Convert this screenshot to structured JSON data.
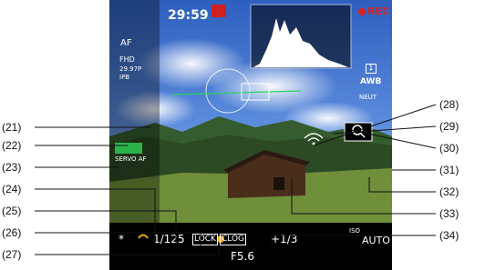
{
  "recording": {
    "time": "29:59",
    "rec_label": "REC"
  },
  "left_column": {
    "af": "AF",
    "iq1": "FHD",
    "iq2": "29.97P",
    "iq3": "IPB",
    "servo": "SERVO AF"
  },
  "right_column": {
    "card": "1",
    "wb": "AWB",
    "pic_style": "NEUT"
  },
  "bottom_bar": {
    "ae_lock": "*",
    "shutter": "1/125",
    "lock": "LOCK",
    "clog": "CLOG",
    "aperture": "F5.6",
    "exposure_comp": "+1/3",
    "iso": "AUTO",
    "aut_label": "ISO"
  },
  "callouts": {
    "left": [
      "(21)",
      "(22)",
      "(23)",
      "(24)",
      "(25)",
      "(26)",
      "(27)"
    ],
    "right": [
      "(28)",
      "(29)",
      "(30)",
      "(31)",
      "(32)",
      "(33)",
      "(34)"
    ]
  },
  "colors": {
    "rec": "#e0201e",
    "badge_red": "#d12020",
    "highlight": "#f2a900",
    "green": "#2bb34a"
  }
}
